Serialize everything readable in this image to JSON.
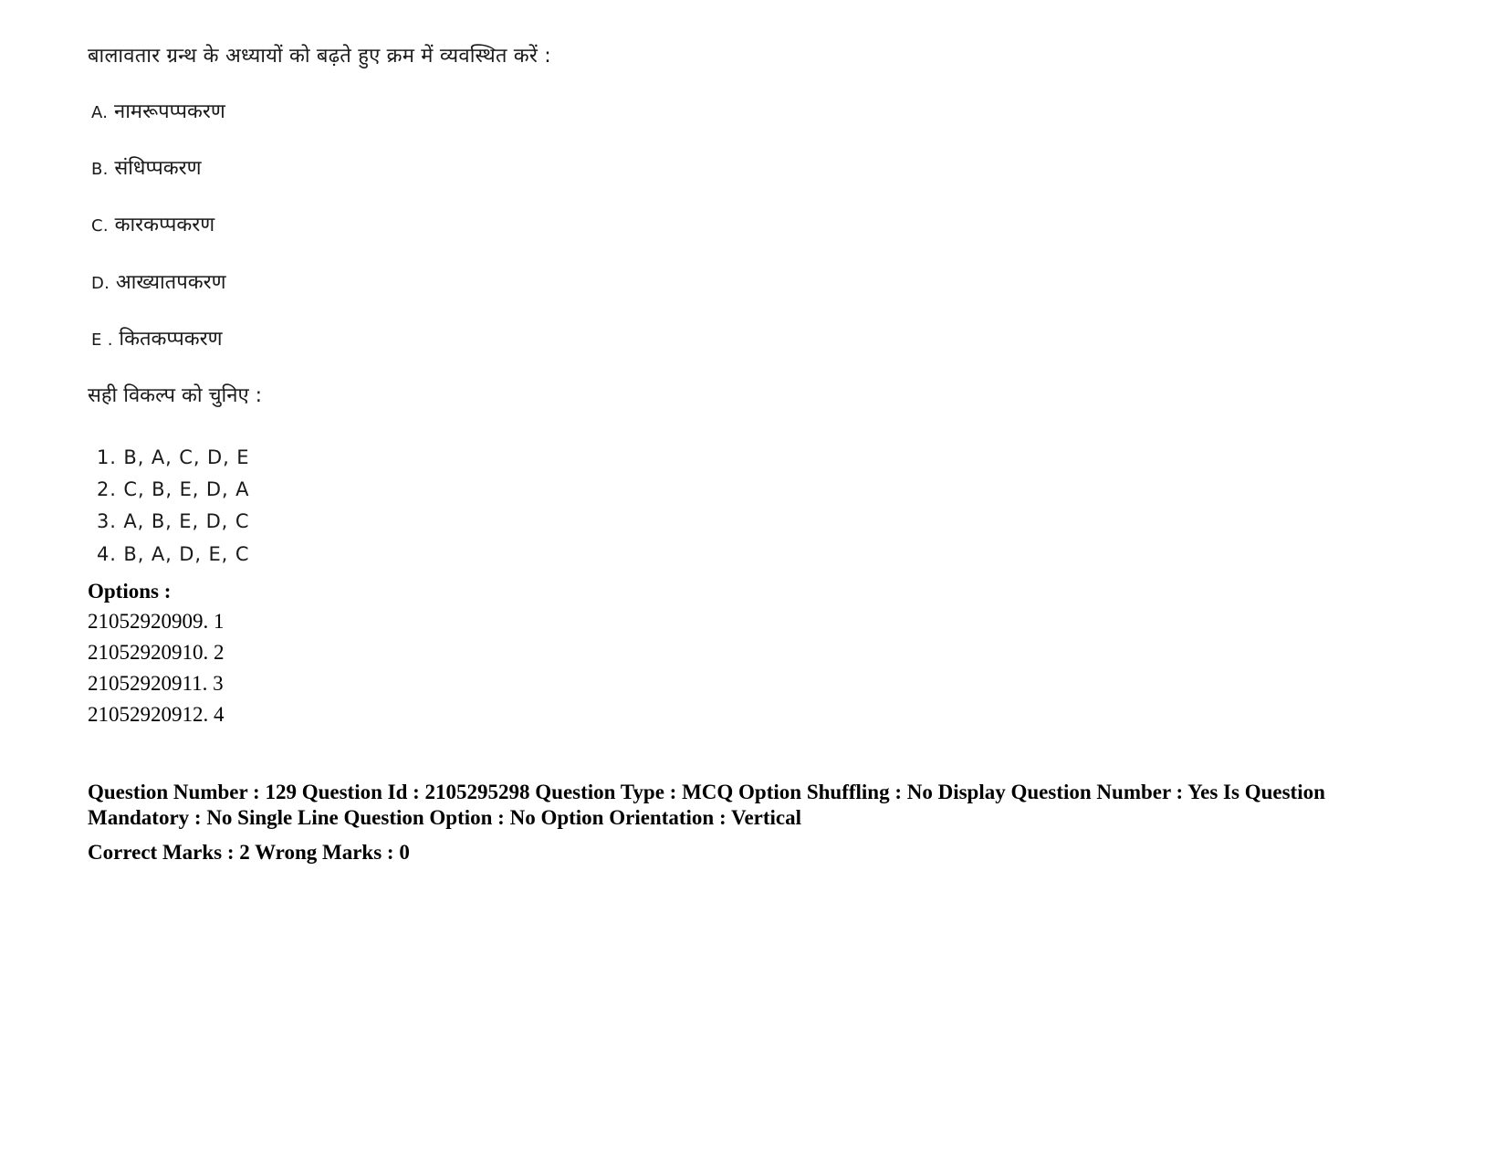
{
  "question": {
    "stem": "बालावतार ग्रन्थ के अध्यायों को बढ़ते हुए क्रम में व्यवस्थित करें :",
    "items": [
      {
        "label": "A.",
        "text": "नामरूपप्पकरण"
      },
      {
        "label": "B.",
        "text": "संधिप्पकरण"
      },
      {
        "label": "C.",
        "text": "कारकप्पकरण"
      },
      {
        "label": "D.",
        "text": "आख्यातपकरण"
      },
      {
        "label": "E .",
        "text": "कितकप्पकरण"
      }
    ],
    "choose_prompt": "सही विकल्प को चुनिए :",
    "choices": [
      "1. B, A, C, D, E",
      "2. C, B, E, D, A",
      "3. A, B, E, D, C",
      "4. B, A, D, E, C"
    ]
  },
  "options": {
    "heading": "Options :",
    "entries": [
      "21052920909. 1",
      "21052920910. 2",
      "21052920911. 3",
      "21052920912. 4"
    ]
  },
  "meta": {
    "line1": "Question Number : 129 Question Id : 2105295298 Question Type : MCQ Option Shuffling : No Display Question Number : Yes Is Question Mandatory : No Single Line Question Option : No Option Orientation : Vertical",
    "line2": "Correct Marks : 2 Wrong Marks : 0"
  }
}
